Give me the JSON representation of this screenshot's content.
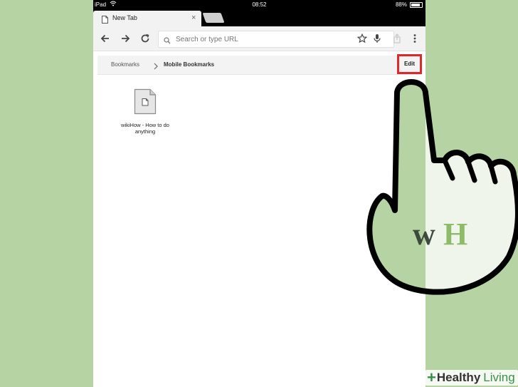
{
  "status_bar": {
    "device": "iPad",
    "time": "08:52",
    "battery": "88%",
    "battery_level": 0.88
  },
  "tabs": {
    "active_title": "New Tab",
    "close_glyph": "×"
  },
  "omnibox": {
    "placeholder": "Search or type URL"
  },
  "breadcrumb": {
    "root": "Bookmarks",
    "current": "Mobile Bookmarks"
  },
  "edit_label": "Edit",
  "bookmarks": [
    {
      "title": "wikiHow - How to do anything",
      "icon": "document-icon"
    }
  ],
  "overlay": {
    "logo_w": "w",
    "logo_h": "H"
  },
  "watermark": {
    "plus": "+",
    "word1": "Healthy",
    "word2": "Living"
  },
  "colors": {
    "background_green": "#b6d4a3",
    "highlight_red": "#e0282a",
    "logo_dark": "#3d4a3d",
    "logo_green": "#8dbb6a"
  }
}
